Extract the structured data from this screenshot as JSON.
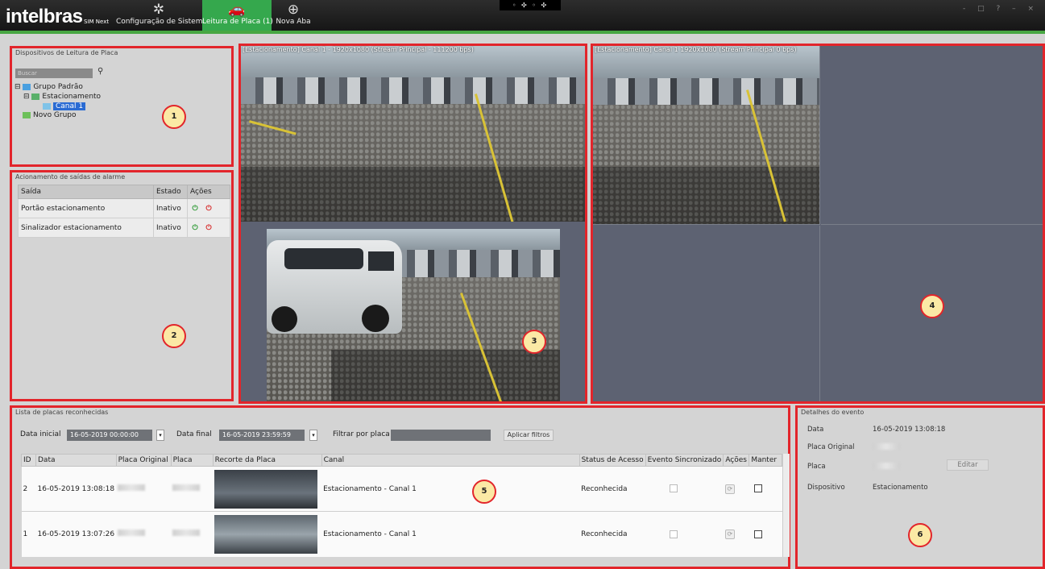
{
  "header": {
    "logo": "intelbras",
    "product": "SIM Next",
    "tabs": [
      {
        "icon": "gear-icon",
        "label": "Configuração de Sistema"
      },
      {
        "icon": "car-icon",
        "label": "Leitura de Placa (1)"
      },
      {
        "icon": "plus-circle-icon",
        "label": "Nova Aba"
      }
    ],
    "window_controls": "- □ ? – ×"
  },
  "devices": {
    "title": "Dispositivos de Leitura de Placa",
    "search_placeholder": "Buscar",
    "tree": [
      "Grupo Padrão",
      "Estacionamento",
      "Canal 1",
      "Novo Grupo"
    ]
  },
  "outputs": {
    "title": "Acionamento de saídas de alarme",
    "columns": [
      "Saída",
      "Estado",
      "Ações"
    ],
    "rows": [
      {
        "name": "Portão estacionamento",
        "state": "Inativo"
      },
      {
        "name": "Sinalizador estacionamento",
        "state": "Inativo"
      }
    ]
  },
  "camera_left_label": "[Estacionamento] Canal 1 - 1920x1080 (Stream Principal - 111200 bps)",
  "camera_right_label": "[Estacionamento] Canal 1   1920x1080 (Stream Principal   0 bps)",
  "plates": {
    "title": "Lista de placas reconhecidas",
    "start_label": "Data inicial",
    "start_value": "16-05-2019 00:00:00",
    "end_label": "Data final",
    "end_value": "16-05-2019 23:59:59",
    "filter_label": "Filtrar por placa",
    "apply_label": "Aplicar filtros",
    "columns": [
      "ID",
      "Data",
      "Placa Original",
      "Placa",
      "Recorte da Placa",
      "Canal",
      "Status de Acesso",
      "Evento Sincronizado",
      "Ações",
      "Manter"
    ],
    "rows": [
      {
        "id": "2",
        "date": "16-05-2019 13:08:18",
        "channel": "Estacionamento - Canal 1",
        "status": "Reconhecida"
      },
      {
        "id": "1",
        "date": "16-05-2019 13:07:26",
        "channel": "Estacionamento - Canal 1",
        "status": "Reconhecida"
      }
    ]
  },
  "details": {
    "title": "Detalhes do evento",
    "fields": [
      {
        "label": "Data",
        "value": "16-05-2019 13:08:18"
      },
      {
        "label": "Placa Original",
        "value": ""
      },
      {
        "label": "Placa",
        "value": ""
      },
      {
        "label": "Dispositivo",
        "value": "Estacionamento"
      }
    ],
    "edit_label": "Editar"
  },
  "callouts": [
    "1",
    "2",
    "3",
    "4",
    "5",
    "6"
  ],
  "colors": {
    "accent": "#35a84d",
    "callout_border": "#e2252b",
    "grid_bg": "#5d6272"
  }
}
